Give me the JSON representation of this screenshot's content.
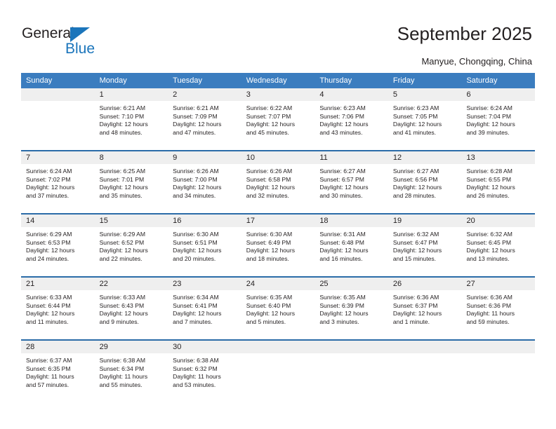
{
  "brand": {
    "name_part1": "General",
    "name_part2": "Blue",
    "triangle_icon": "blue-triangle-icon",
    "colors": {
      "dark": "#231f20",
      "blue": "#1b75bb"
    }
  },
  "header": {
    "title": "September 2025",
    "subtitle": "Manyue, Chongqing, China"
  },
  "colors": {
    "header_row_bg": "#3b7dbf",
    "week_divider": "#2b6ca8",
    "day_band_bg": "#efefef",
    "text": "#231f20"
  },
  "weekdays": [
    "Sunday",
    "Monday",
    "Tuesday",
    "Wednesday",
    "Thursday",
    "Friday",
    "Saturday"
  ],
  "weeks": [
    [
      {
        "day": "",
        "empty": true,
        "sunrise": "",
        "sunset": "",
        "daylight_line1": "",
        "daylight_line2": ""
      },
      {
        "day": "1",
        "empty": false,
        "sunrise": "Sunrise: 6:21 AM",
        "sunset": "Sunset: 7:10 PM",
        "daylight_line1": "Daylight: 12 hours",
        "daylight_line2": "and 48 minutes."
      },
      {
        "day": "2",
        "empty": false,
        "sunrise": "Sunrise: 6:21 AM",
        "sunset": "Sunset: 7:09 PM",
        "daylight_line1": "Daylight: 12 hours",
        "daylight_line2": "and 47 minutes."
      },
      {
        "day": "3",
        "empty": false,
        "sunrise": "Sunrise: 6:22 AM",
        "sunset": "Sunset: 7:07 PM",
        "daylight_line1": "Daylight: 12 hours",
        "daylight_line2": "and 45 minutes."
      },
      {
        "day": "4",
        "empty": false,
        "sunrise": "Sunrise: 6:23 AM",
        "sunset": "Sunset: 7:06 PM",
        "daylight_line1": "Daylight: 12 hours",
        "daylight_line2": "and 43 minutes."
      },
      {
        "day": "5",
        "empty": false,
        "sunrise": "Sunrise: 6:23 AM",
        "sunset": "Sunset: 7:05 PM",
        "daylight_line1": "Daylight: 12 hours",
        "daylight_line2": "and 41 minutes."
      },
      {
        "day": "6",
        "empty": false,
        "sunrise": "Sunrise: 6:24 AM",
        "sunset": "Sunset: 7:04 PM",
        "daylight_line1": "Daylight: 12 hours",
        "daylight_line2": "and 39 minutes."
      }
    ],
    [
      {
        "day": "7",
        "empty": false,
        "sunrise": "Sunrise: 6:24 AM",
        "sunset": "Sunset: 7:02 PM",
        "daylight_line1": "Daylight: 12 hours",
        "daylight_line2": "and 37 minutes."
      },
      {
        "day": "8",
        "empty": false,
        "sunrise": "Sunrise: 6:25 AM",
        "sunset": "Sunset: 7:01 PM",
        "daylight_line1": "Daylight: 12 hours",
        "daylight_line2": "and 35 minutes."
      },
      {
        "day": "9",
        "empty": false,
        "sunrise": "Sunrise: 6:26 AM",
        "sunset": "Sunset: 7:00 PM",
        "daylight_line1": "Daylight: 12 hours",
        "daylight_line2": "and 34 minutes."
      },
      {
        "day": "10",
        "empty": false,
        "sunrise": "Sunrise: 6:26 AM",
        "sunset": "Sunset: 6:58 PM",
        "daylight_line1": "Daylight: 12 hours",
        "daylight_line2": "and 32 minutes."
      },
      {
        "day": "11",
        "empty": false,
        "sunrise": "Sunrise: 6:27 AM",
        "sunset": "Sunset: 6:57 PM",
        "daylight_line1": "Daylight: 12 hours",
        "daylight_line2": "and 30 minutes."
      },
      {
        "day": "12",
        "empty": false,
        "sunrise": "Sunrise: 6:27 AM",
        "sunset": "Sunset: 6:56 PM",
        "daylight_line1": "Daylight: 12 hours",
        "daylight_line2": "and 28 minutes."
      },
      {
        "day": "13",
        "empty": false,
        "sunrise": "Sunrise: 6:28 AM",
        "sunset": "Sunset: 6:55 PM",
        "daylight_line1": "Daylight: 12 hours",
        "daylight_line2": "and 26 minutes."
      }
    ],
    [
      {
        "day": "14",
        "empty": false,
        "sunrise": "Sunrise: 6:29 AM",
        "sunset": "Sunset: 6:53 PM",
        "daylight_line1": "Daylight: 12 hours",
        "daylight_line2": "and 24 minutes."
      },
      {
        "day": "15",
        "empty": false,
        "sunrise": "Sunrise: 6:29 AM",
        "sunset": "Sunset: 6:52 PM",
        "daylight_line1": "Daylight: 12 hours",
        "daylight_line2": "and 22 minutes."
      },
      {
        "day": "16",
        "empty": false,
        "sunrise": "Sunrise: 6:30 AM",
        "sunset": "Sunset: 6:51 PM",
        "daylight_line1": "Daylight: 12 hours",
        "daylight_line2": "and 20 minutes."
      },
      {
        "day": "17",
        "empty": false,
        "sunrise": "Sunrise: 6:30 AM",
        "sunset": "Sunset: 6:49 PM",
        "daylight_line1": "Daylight: 12 hours",
        "daylight_line2": "and 18 minutes."
      },
      {
        "day": "18",
        "empty": false,
        "sunrise": "Sunrise: 6:31 AM",
        "sunset": "Sunset: 6:48 PM",
        "daylight_line1": "Daylight: 12 hours",
        "daylight_line2": "and 16 minutes."
      },
      {
        "day": "19",
        "empty": false,
        "sunrise": "Sunrise: 6:32 AM",
        "sunset": "Sunset: 6:47 PM",
        "daylight_line1": "Daylight: 12 hours",
        "daylight_line2": "and 15 minutes."
      },
      {
        "day": "20",
        "empty": false,
        "sunrise": "Sunrise: 6:32 AM",
        "sunset": "Sunset: 6:45 PM",
        "daylight_line1": "Daylight: 12 hours",
        "daylight_line2": "and 13 minutes."
      }
    ],
    [
      {
        "day": "21",
        "empty": false,
        "sunrise": "Sunrise: 6:33 AM",
        "sunset": "Sunset: 6:44 PM",
        "daylight_line1": "Daylight: 12 hours",
        "daylight_line2": "and 11 minutes."
      },
      {
        "day": "22",
        "empty": false,
        "sunrise": "Sunrise: 6:33 AM",
        "sunset": "Sunset: 6:43 PM",
        "daylight_line1": "Daylight: 12 hours",
        "daylight_line2": "and 9 minutes."
      },
      {
        "day": "23",
        "empty": false,
        "sunrise": "Sunrise: 6:34 AM",
        "sunset": "Sunset: 6:41 PM",
        "daylight_line1": "Daylight: 12 hours",
        "daylight_line2": "and 7 minutes."
      },
      {
        "day": "24",
        "empty": false,
        "sunrise": "Sunrise: 6:35 AM",
        "sunset": "Sunset: 6:40 PM",
        "daylight_line1": "Daylight: 12 hours",
        "daylight_line2": "and 5 minutes."
      },
      {
        "day": "25",
        "empty": false,
        "sunrise": "Sunrise: 6:35 AM",
        "sunset": "Sunset: 6:39 PM",
        "daylight_line1": "Daylight: 12 hours",
        "daylight_line2": "and 3 minutes."
      },
      {
        "day": "26",
        "empty": false,
        "sunrise": "Sunrise: 6:36 AM",
        "sunset": "Sunset: 6:37 PM",
        "daylight_line1": "Daylight: 12 hours",
        "daylight_line2": "and 1 minute."
      },
      {
        "day": "27",
        "empty": false,
        "sunrise": "Sunrise: 6:36 AM",
        "sunset": "Sunset: 6:36 PM",
        "daylight_line1": "Daylight: 11 hours",
        "daylight_line2": "and 59 minutes."
      }
    ],
    [
      {
        "day": "28",
        "empty": false,
        "sunrise": "Sunrise: 6:37 AM",
        "sunset": "Sunset: 6:35 PM",
        "daylight_line1": "Daylight: 11 hours",
        "daylight_line2": "and 57 minutes."
      },
      {
        "day": "29",
        "empty": false,
        "sunrise": "Sunrise: 6:38 AM",
        "sunset": "Sunset: 6:34 PM",
        "daylight_line1": "Daylight: 11 hours",
        "daylight_line2": "and 55 minutes."
      },
      {
        "day": "30",
        "empty": false,
        "sunrise": "Sunrise: 6:38 AM",
        "sunset": "Sunset: 6:32 PM",
        "daylight_line1": "Daylight: 11 hours",
        "daylight_line2": "and 53 minutes."
      },
      {
        "day": "",
        "empty": true,
        "sunrise": "",
        "sunset": "",
        "daylight_line1": "",
        "daylight_line2": ""
      },
      {
        "day": "",
        "empty": true,
        "sunrise": "",
        "sunset": "",
        "daylight_line1": "",
        "daylight_line2": ""
      },
      {
        "day": "",
        "empty": true,
        "sunrise": "",
        "sunset": "",
        "daylight_line1": "",
        "daylight_line2": ""
      },
      {
        "day": "",
        "empty": true,
        "sunrise": "",
        "sunset": "",
        "daylight_line1": "",
        "daylight_line2": ""
      }
    ]
  ]
}
